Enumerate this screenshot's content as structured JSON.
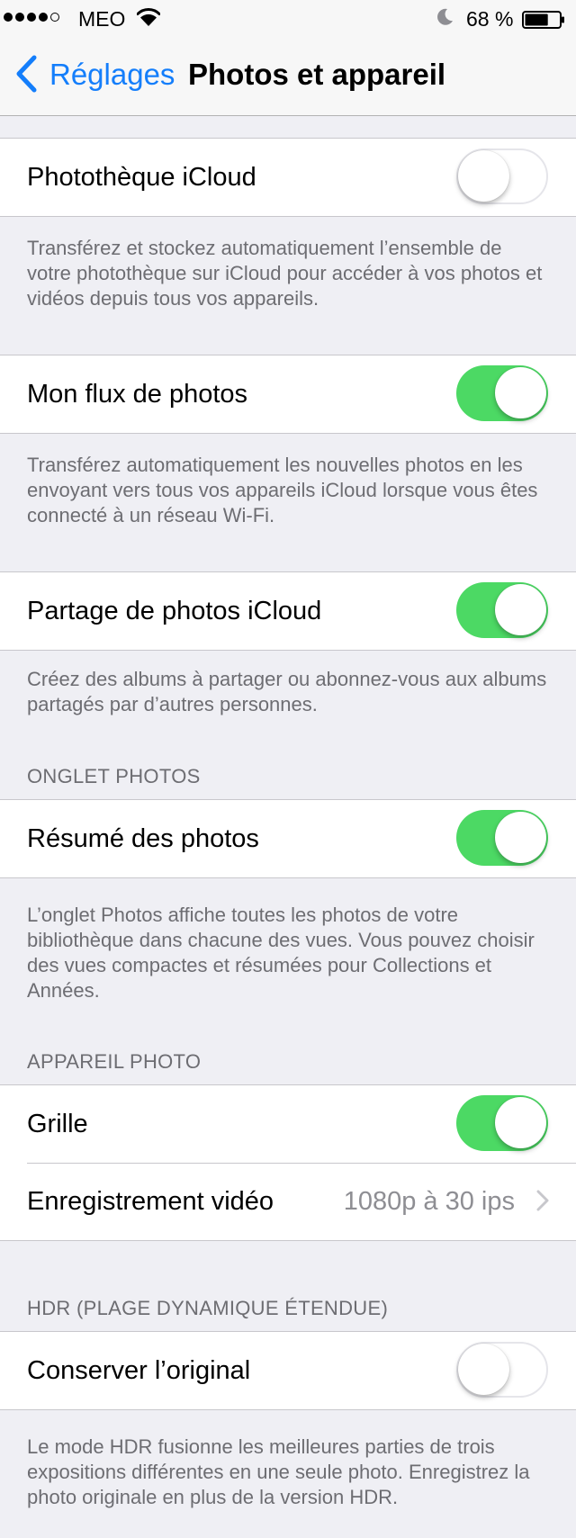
{
  "status_bar": {
    "carrier": "MEO",
    "battery_percent": "68 %",
    "battery_level": 0.68,
    "signal_bars": 4,
    "signal_max": 5
  },
  "nav": {
    "back_label": "Réglages",
    "title": "Photos et appareil"
  },
  "colors": {
    "accent": "#147efb",
    "toggle_on": "#4cd964",
    "background": "#efeff4",
    "secondary_text": "#6d6d72"
  },
  "sections": {
    "icloud_library": {
      "label": "Photothèque iCloud",
      "enabled": false,
      "footer": "Transférez et stockez automatiquement l’ensemble de votre photothèque sur iCloud pour accéder à vos photos et vidéos depuis tous vos appareils."
    },
    "photo_stream": {
      "label": "Mon flux de photos",
      "enabled": true,
      "footer": "Transférez automatiquement les nouvelles photos en les envoyant vers tous vos appareils iCloud lorsque vous êtes connecté à un réseau Wi-Fi."
    },
    "photo_sharing": {
      "label": "Partage de photos iCloud",
      "enabled": true,
      "footer": "Créez des albums à partager ou abonnez-vous aux albums partagés par d’autres personnes."
    },
    "photos_tab": {
      "header": "ONGLET PHOTOS",
      "label": "Résumé des photos",
      "enabled": true,
      "footer": "L’onglet Photos affiche toutes les photos de votre bibliothèque dans chacune des vues. Vous pouvez choisir des vues compactes et résumées pour Collections et Années."
    },
    "camera": {
      "header": "APPAREIL PHOTO",
      "grid_label": "Grille",
      "grid_enabled": true,
      "video_label": "Enregistrement vidéo",
      "video_value": "1080p à 30 ips"
    },
    "hdr": {
      "header": "HDR (PLAGE DYNAMIQUE ÉTENDUE)",
      "label": "Conserver l’original",
      "enabled": false,
      "footer": "Le mode HDR fusionne les meilleures parties de trois expositions différentes en une seule photo. Enregistrez la photo originale en plus de la version HDR."
    }
  }
}
